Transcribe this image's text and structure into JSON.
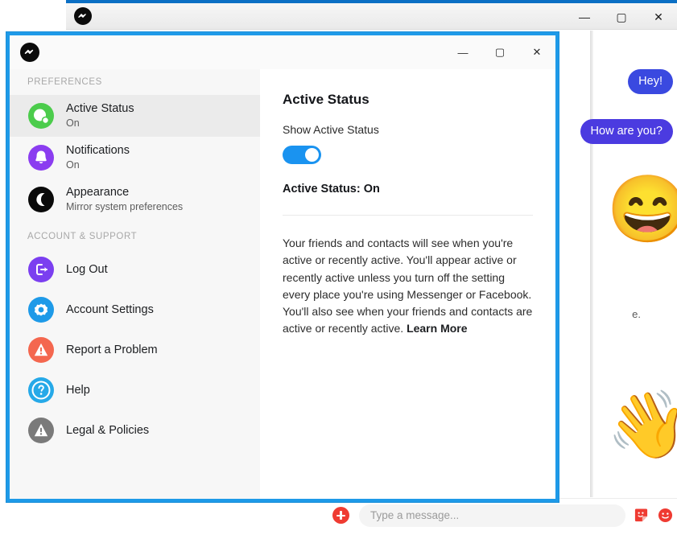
{
  "background_window": {
    "app_logo": "messenger-logo-icon",
    "window_controls": {
      "minimize": "—",
      "maximize": "▢",
      "close": "✕"
    },
    "chat": {
      "menu_icon": "kebab-menu-icon",
      "messages": [
        {
          "text": "Hey!",
          "color": "#3a49e0",
          "status": "delivered",
          "status_color": "#4b3be0"
        },
        {
          "text": "How are you?",
          "color": "#4b3be0",
          "status": "delivered",
          "status_color": "#4b3be0"
        },
        {
          "text": "😄",
          "type": "emoji",
          "status": "delivered",
          "status_color": "#8a2be2"
        },
        {
          "text": "👋",
          "type": "emoji",
          "status": "delivered",
          "status_color": "#d12a6e"
        }
      ],
      "clipped_text": "e.",
      "composer": {
        "add_label": "+",
        "placeholder": "Type a message...",
        "value": "",
        "icons": [
          "sticker-icon",
          "emoji-icon",
          "thumbs-up-icon"
        ]
      }
    }
  },
  "dialog": {
    "logo": "messenger-logo-icon",
    "window_controls": {
      "minimize": "—",
      "maximize": "▢",
      "close": "✕"
    },
    "sidebar": {
      "sections": [
        {
          "header": "PREFERENCES",
          "items": [
            {
              "label": "Active Status",
              "sub": "On",
              "icon": "active-status-icon",
              "color": "#4ccc4c",
              "selected": true
            },
            {
              "label": "Notifications",
              "sub": "On",
              "icon": "bell-icon",
              "color": "#8b3df0",
              "selected": false
            },
            {
              "label": "Appearance",
              "sub": "Mirror system preferences",
              "icon": "moon-icon",
              "color": "#0a0a0a",
              "selected": false
            }
          ]
        },
        {
          "header": "ACCOUNT & SUPPORT",
          "items": [
            {
              "label": "Log Out",
              "sub": "",
              "icon": "logout-icon",
              "color": "#7b3ff0",
              "selected": false
            },
            {
              "label": "Account Settings",
              "sub": "",
              "icon": "gear-icon",
              "color": "#1e9ae8",
              "selected": false
            },
            {
              "label": "Report a Problem",
              "sub": "",
              "icon": "warning-icon",
              "color": "#f4674f",
              "selected": false
            },
            {
              "label": "Help",
              "sub": "",
              "icon": "question-icon",
              "color": "#26a9e8",
              "selected": false
            },
            {
              "label": "Legal & Policies",
              "sub": "",
              "icon": "warning-icon",
              "color": "#7a7a7a",
              "selected": false
            }
          ]
        }
      ]
    },
    "content": {
      "title": "Active Status",
      "toggle_label": "Show Active Status",
      "toggle_on": true,
      "toggle_color": "#1a93f0",
      "status_line": "Active Status: On",
      "description": "Your friends and contacts will see when you're active or recently active. You'll appear active or recently active unless you turn off the setting every place you're using Messenger or Facebook. You'll also see when your friends and contacts are active or recently active. ",
      "learn_more": "Learn More"
    }
  }
}
